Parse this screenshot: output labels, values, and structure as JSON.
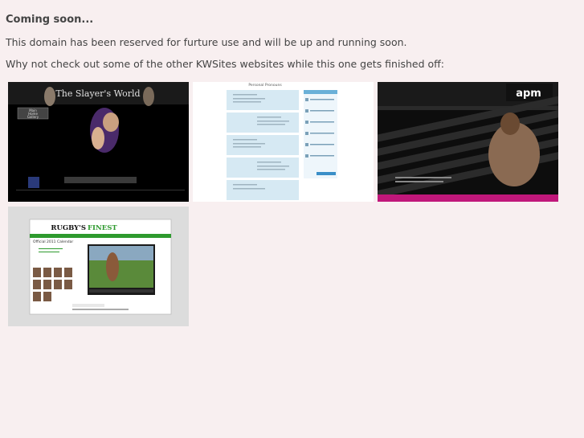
{
  "page": {
    "heading": "Coming soon...",
    "line1": "This domain has been reserved for furture use and will be up and running soon.",
    "line2": "Why not check out some of the other KWSites websites while this one gets finished off:"
  },
  "sites": [
    {
      "title": "The Slayer's World",
      "menu": [
        "Main",
        "Home",
        "Gallery"
      ]
    },
    {
      "title": "Personal Pronouns"
    },
    {
      "brand": "apm"
    },
    {
      "title_part1": "RUGBY'S",
      "title_part2": "FINEST",
      "subtitle": "Official 2011 Calendar"
    }
  ],
  "colors": {
    "background": "#f8eff0",
    "text": "#444444",
    "rugby_green": "#2e9a2e",
    "apm_magenta": "#c0177a"
  }
}
